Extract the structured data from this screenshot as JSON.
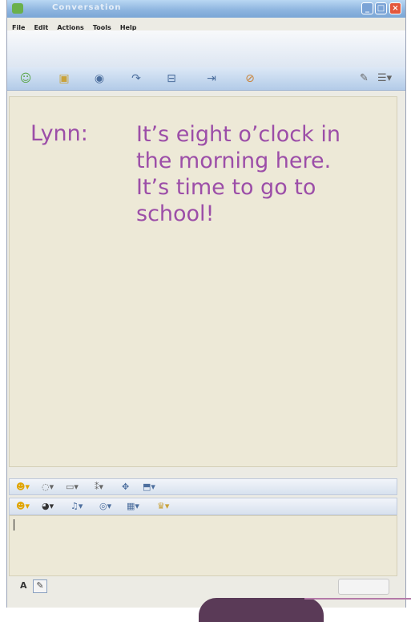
{
  "window": {
    "title": "Conversation"
  },
  "menu": [
    "File",
    "Edit",
    "Actions",
    "Tools",
    "Help"
  ],
  "toolbar": {
    "icons": [
      "invite-contact-icon",
      "send-files-icon",
      "webcam-icon",
      "call-icon",
      "share-folder-icon",
      "activities-icon",
      "block-icon"
    ],
    "right_icons": [
      "pen-icon",
      "options-icon"
    ]
  },
  "conversation": {
    "sender": "Lynn:",
    "message_lines": [
      "It’s eight o’clock in",
      "the morning here.",
      "It’s time to go to",
      "school!"
    ]
  },
  "emoticon_bar_1": [
    "smile-emoticon",
    "wink-icon",
    "voice-clip-icon",
    "nudge-icon",
    "background-icon",
    "games-icon"
  ],
  "emoticon_bar_2": [
    "emoticons-icon",
    "winks-icon",
    "voice-icon",
    "nudge-icon",
    "background-icon",
    "font-icon"
  ],
  "bottom": {
    "font_label": "A",
    "send_label": ""
  },
  "colors": {
    "message": "#9c4ea8",
    "conversation_bg": "#ede9d7",
    "title_bar": "#8fb6e0"
  }
}
